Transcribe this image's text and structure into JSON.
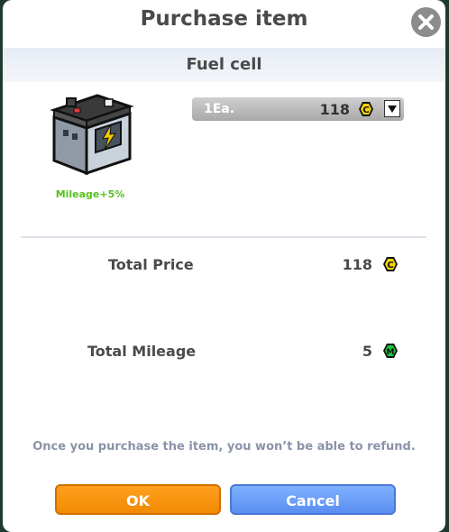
{
  "dialog": {
    "title": "Purchase item"
  },
  "item": {
    "name": "Fuel cell",
    "effect": "Mileage+5%"
  },
  "quantity": {
    "label": "1Ea.",
    "price": "118"
  },
  "totals": {
    "price_label": "Total Price",
    "price_value": "118",
    "mileage_label": "Total Mileage",
    "mileage_value": "5"
  },
  "notice": "Once you purchase the item, you won’t be able to refund.",
  "buttons": {
    "ok": "OK",
    "cancel": "Cancel"
  },
  "colors": {
    "ok": "#f18a00",
    "cancel": "#5a8ef0",
    "effect": "#59c01f",
    "coin": "#f2d200",
    "mileage": "#16c93c"
  },
  "icons": {
    "close": "close-icon",
    "coin": "c-coin-icon",
    "mileage": "m-mileage-icon",
    "item": "battery-icon",
    "dropdown": "triangle-down-icon"
  }
}
